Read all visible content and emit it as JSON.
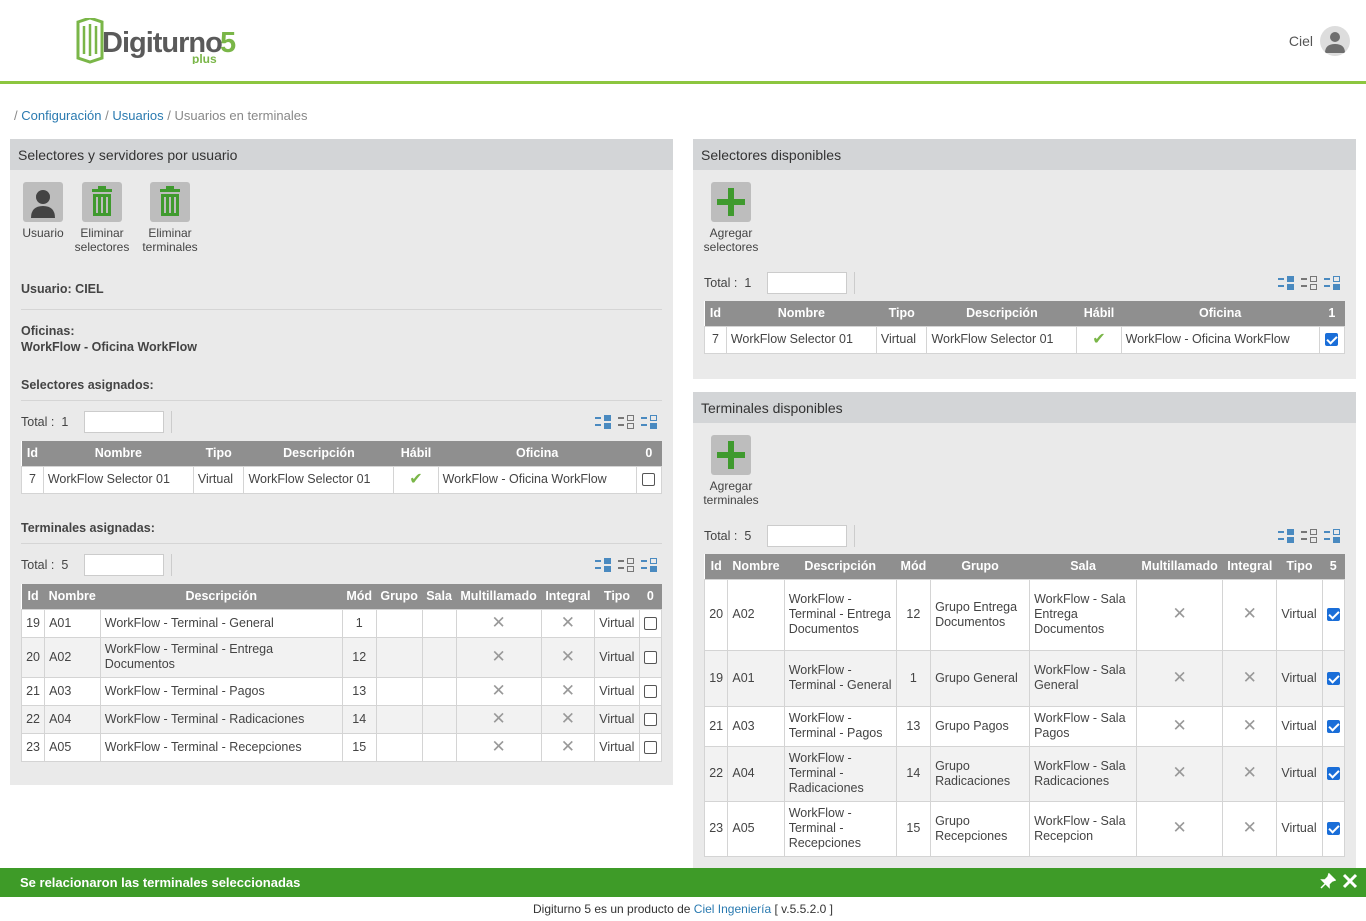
{
  "header": {
    "logo_text": "Digiturno",
    "logo_number": "5",
    "logo_plus": "plus",
    "user_name": "Ciel"
  },
  "breadcrumb": {
    "sep": "/",
    "item1": "Configuración",
    "item2": "Usuarios",
    "item3": "Usuarios en terminales"
  },
  "left_panel": {
    "title": "Selectores y servidores por usuario",
    "toolbar": {
      "user_btn": "Usuario",
      "del_sel_1": "Eliminar",
      "del_sel_2": "selectores",
      "del_term_1": "Eliminar",
      "del_term_2": "terminales"
    },
    "user_label": "Usuario: CIEL",
    "offices_label": "Oficinas:",
    "offices_value": "WorkFlow - Oficina WorkFlow",
    "selectors_section": "Selectores asignados:",
    "terminals_section": "Terminales asignadas:",
    "sel_total_label": "Total :",
    "sel_total": "1",
    "term_total_label": "Total :",
    "term_total": "5",
    "sel_headers": [
      "Id",
      "Nombre",
      "Tipo",
      "Descripción",
      "Hábil",
      "Oficina",
      "0"
    ],
    "sel_rows": [
      {
        "id": "7",
        "nombre": "WorkFlow Selector 01",
        "tipo": "Virtual",
        "desc": "WorkFlow Selector 01",
        "oficina": "WorkFlow - Oficina WorkFlow"
      }
    ],
    "term_headers": [
      "Id",
      "Nombre",
      "Descripción",
      "Mód",
      "Grupo",
      "Sala",
      "Multillamado",
      "Integral",
      "Tipo",
      "0"
    ],
    "term_rows": [
      {
        "id": "19",
        "nombre": "A01",
        "desc": "WorkFlow - Terminal - General",
        "mod": "1",
        "tipo": "Virtual"
      },
      {
        "id": "20",
        "nombre": "A02",
        "desc": "WorkFlow - Terminal - Entrega Documentos",
        "mod": "12",
        "tipo": "Virtual"
      },
      {
        "id": "21",
        "nombre": "A03",
        "desc": "WorkFlow - Terminal - Pagos",
        "mod": "13",
        "tipo": "Virtual"
      },
      {
        "id": "22",
        "nombre": "A04",
        "desc": "WorkFlow - Terminal - Radicaciones",
        "mod": "14",
        "tipo": "Virtual"
      },
      {
        "id": "23",
        "nombre": "A05",
        "desc": "WorkFlow - Terminal - Recepciones",
        "mod": "15",
        "tipo": "Virtual"
      }
    ]
  },
  "right_top": {
    "title": "Selectores disponibles",
    "add_1": "Agregar",
    "add_2": "selectores",
    "total_label": "Total :",
    "total": "1",
    "headers": [
      "Id",
      "Nombre",
      "Tipo",
      "Descripción",
      "Hábil",
      "Oficina",
      "1"
    ],
    "rows": [
      {
        "id": "7",
        "nombre": "WorkFlow Selector 01",
        "tipo": "Virtual",
        "desc": "WorkFlow Selector 01",
        "oficina": "WorkFlow - Oficina WorkFlow"
      }
    ]
  },
  "right_bottom": {
    "title": "Terminales disponibles",
    "add_1": "Agregar",
    "add_2": "terminales",
    "total_label": "Total :",
    "total": "5",
    "headers": [
      "Id",
      "Nombre",
      "Descripción",
      "Mód",
      "Grupo",
      "Sala",
      "Multillamado",
      "Integral",
      "Tipo",
      "5"
    ],
    "rows": [
      {
        "id": "20",
        "nombre": "A02",
        "desc": "WorkFlow - Terminal - Entrega Documentos",
        "mod": "12",
        "grupo": "Grupo Entrega Documentos",
        "sala": "WorkFlow - Sala Entrega Documentos",
        "tipo": "Virtual"
      },
      {
        "id": "19",
        "nombre": "A01",
        "desc": "WorkFlow - Terminal - General",
        "mod": "1",
        "grupo": "Grupo General",
        "sala": "WorkFlow - Sala General",
        "tipo": "Virtual"
      },
      {
        "id": "21",
        "nombre": "A03",
        "desc": "WorkFlow - Terminal - Pagos",
        "mod": "13",
        "grupo": "Grupo Pagos",
        "sala": "WorkFlow - Sala Pagos",
        "tipo": "Virtual"
      },
      {
        "id": "22",
        "nombre": "A04",
        "desc": "WorkFlow - Terminal - Radicaciones",
        "mod": "14",
        "grupo": "Grupo Radicaciones",
        "sala": "WorkFlow - Sala Radicaciones",
        "tipo": "Virtual"
      },
      {
        "id": "23",
        "nombre": "A05",
        "desc": "WorkFlow - Terminal - Recepciones",
        "mod": "15",
        "grupo": "Grupo Recepciones",
        "sala": "WorkFlow - Sala Recepcion",
        "tipo": "Virtual"
      }
    ]
  },
  "status_message": "Se relacionaron las terminales seleccionadas",
  "footer": {
    "text1": "Digiturno 5 es un producto de",
    "link": "Ciel Ingeniería",
    "version": "[ v.5.5.2.0 ]"
  },
  "colors": {
    "accent": "#8cc63f",
    "status_bar": "#3e9b28",
    "table_header": "#8f8f8f",
    "link": "#2a7ab0"
  }
}
